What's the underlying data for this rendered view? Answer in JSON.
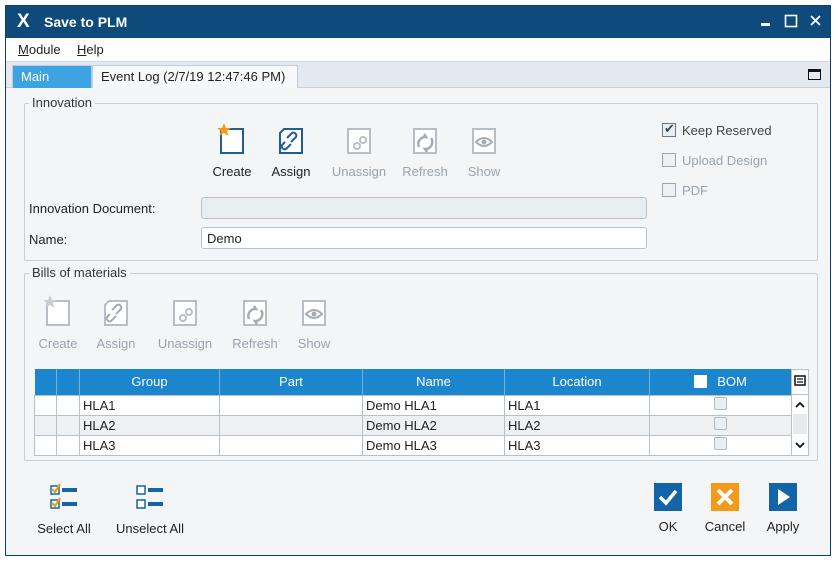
{
  "window": {
    "logo": "X",
    "title": "Save to PLM"
  },
  "menu": {
    "items": [
      "Module",
      "Help"
    ]
  },
  "tabs": [
    {
      "label": "Main",
      "active": true
    },
    {
      "label": "Event Log (2/7/19 12:47:46 PM)",
      "active": false
    }
  ],
  "innovation": {
    "legend": "Innovation",
    "tools": [
      {
        "label": "Create",
        "icon": "create-icon",
        "enabled": true
      },
      {
        "label": "Assign",
        "icon": "assign-link-icon",
        "enabled": true
      },
      {
        "label": "Unassign",
        "icon": "unassign-link-icon",
        "enabled": false
      },
      {
        "label": "Refresh",
        "icon": "refresh-icon",
        "enabled": false
      },
      {
        "label": "Show",
        "icon": "show-eye-icon",
        "enabled": false
      }
    ],
    "options": [
      {
        "label": "Keep Reserved",
        "checked": true,
        "enabled": true
      },
      {
        "label": "Upload Design",
        "checked": false,
        "enabled": false
      },
      {
        "label": "PDF",
        "checked": false,
        "enabled": false
      }
    ],
    "document_label": "Innovation Document:",
    "document_value": "",
    "name_label": "Name:",
    "name_value": "Demo"
  },
  "bom": {
    "legend": "Bills of materials",
    "tools": [
      {
        "label": "Create",
        "icon": "create-icon",
        "enabled": false
      },
      {
        "label": "Assign",
        "icon": "assign-link-icon",
        "enabled": false
      },
      {
        "label": "Unassign",
        "icon": "unassign-link-icon",
        "enabled": false
      },
      {
        "label": "Refresh",
        "icon": "refresh-icon",
        "enabled": false
      },
      {
        "label": "Show",
        "icon": "show-eye-icon",
        "enabled": false
      }
    ],
    "columns": [
      "Group",
      "Part",
      "Name",
      "Location",
      "BOM"
    ],
    "rows": [
      {
        "group": "HLA1",
        "part": "",
        "name": "Demo HLA1",
        "location": "HLA1",
        "bom": false
      },
      {
        "group": "HLA2",
        "part": "",
        "name": "Demo HLA2",
        "location": "HLA2",
        "bom": false
      },
      {
        "group": "HLA3",
        "part": "",
        "name": "Demo HLA3",
        "location": "HLA3",
        "bom": false
      }
    ]
  },
  "footer": {
    "select_all": "Select All",
    "unselect_all": "Unselect All",
    "ok": "OK",
    "cancel": "Cancel",
    "apply": "Apply"
  },
  "colors": {
    "titlebar": "#0f4a7d",
    "active_tab": "#3ea3e2",
    "grid_header": "#1b86cd",
    "ok": "#1465a8",
    "cancel": "#f39a1b",
    "apply": "#1465a8"
  }
}
